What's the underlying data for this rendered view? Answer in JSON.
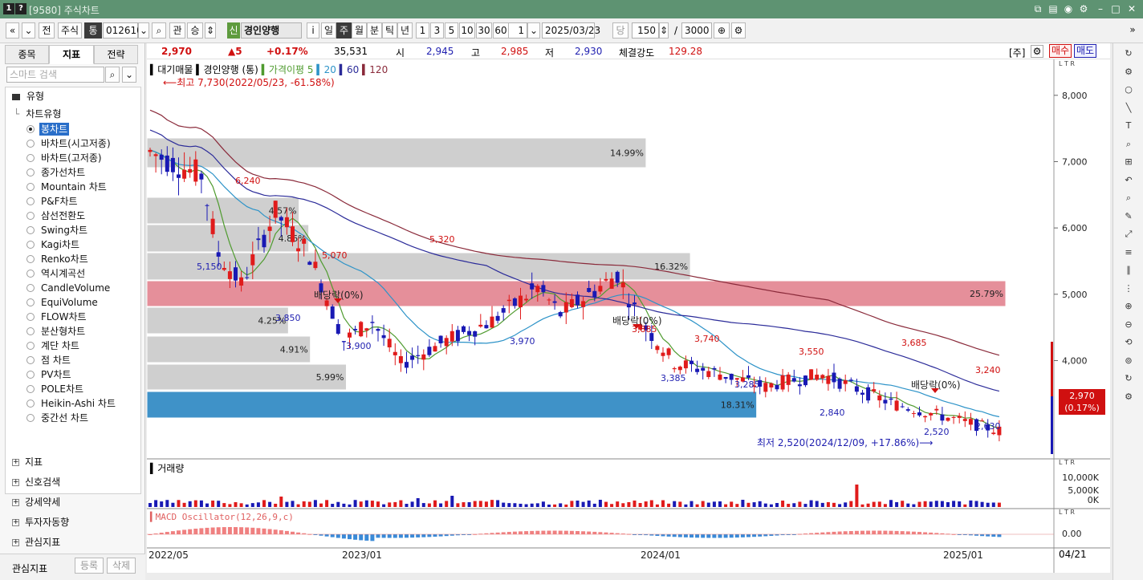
{
  "titlebar": {
    "num1": "1",
    "num2": "?",
    "title": "[9580] 주식차트"
  },
  "toolbar": {
    "nav_prev": "«",
    "nav_more": "»",
    "jeon": "전",
    "jusik": "주식",
    "tong": "통",
    "code": "012610",
    "gwan": "관",
    "seung": "승",
    "sin_badge": "신",
    "stock_name": "경인양행",
    "info": "i",
    "periods": [
      "일",
      "주",
      "월",
      "분",
      "틱",
      "년"
    ],
    "selected_period": "주",
    "minutes": [
      "1",
      "3",
      "5",
      "10",
      "30",
      "60"
    ],
    "unit_count": "1",
    "date": "2025/03/23",
    "dang": "당",
    "count": "150",
    "slash": "/",
    "max_count": "3000"
  },
  "left": {
    "tabs": [
      "종목",
      "지표",
      "전략"
    ],
    "active_tab": "지표",
    "search_placeholder": "스마트 검색",
    "type_header": "유형",
    "category": "차트유형",
    "chart_types": [
      "봉차트",
      "바차트(시고저종)",
      "바차트(고저종)",
      "종가선차트",
      "Mountain 차트",
      "P&F차트",
      "삼선전환도",
      "Swing차트",
      "Kagi차트",
      "Renko차트",
      "역시계곡선",
      "CandleVolume",
      "EquiVolume",
      "FLOW차트",
      "분산형차트",
      "계단 차트",
      "점 차트",
      "PV차트",
      "POLE차트",
      "Heikin-Ashi 차트",
      "중간선 차트"
    ],
    "selected_type": "봉차트",
    "sections": [
      "지표",
      "신호검색",
      "강세약세",
      "투자자동향",
      "관심지표"
    ],
    "bottom_label": "관심지표",
    "register": "등록",
    "delete": "삭제"
  },
  "quote": {
    "price": "2,970",
    "change": "▲5",
    "pct": "+0.17%",
    "volume": "35,531",
    "open_label": "시",
    "open": "2,945",
    "high_label": "고",
    "high": "2,985",
    "low_label": "저",
    "low": "2,930",
    "strength_label": "체결강도",
    "strength": "129.28",
    "unit": "[주]",
    "buy": "매수",
    "sell": "매도"
  },
  "chart": {
    "legend_vp": "대기매물",
    "legend_stock": "경인양행 (통)",
    "legend_ma": "가격이평 5",
    "legend_ma2": "20",
    "legend_ma3": "60",
    "legend_ma4": "120",
    "max_note": "⟵최고 7,730(2022/05/23, -61.58%)",
    "min_note": "최저 2,520(2024/12/09, +17.86%)⟶",
    "dividend_label": "배당락(0%)",
    "last_price": "2,970",
    "last_pct": "(0.17%)",
    "volume_title": "거래량",
    "macd_title": "MACD Oscillator(12,26,9,c)",
    "time_end": "04/21",
    "ltr": "L T R",
    "colors": {
      "up": "#e01b1b",
      "down": "#1919b4",
      "ma5": "#4f9b2f",
      "ma20": "#2d93c8",
      "ma60": "#2b2b99",
      "ma120": "#8a2a3a"
    }
  },
  "chart_data": {
    "type": "candlestick",
    "price_axis": {
      "ticks": [
        8000,
        7000,
        6000,
        5000,
        4000
      ],
      "range": [
        2300,
        8300
      ]
    },
    "volume_axis": {
      "ticks": [
        "10,000K",
        "5,000K",
        "0K"
      ]
    },
    "macd_axis": {
      "ticks": [
        "0.00"
      ]
    },
    "time_axis": {
      "labels": [
        "2022/05",
        "2023/01",
        "2024/01",
        "2025/01"
      ]
    },
    "price_labels": [
      "6,240",
      "5,150",
      "5,070",
      "3,850",
      "3,900",
      "5,320",
      "3,970",
      "3,885",
      "3,740",
      "3,385",
      "3,285",
      "3,550",
      "2,840",
      "3,685",
      "3,240",
      "2,520",
      "2,630"
    ],
    "volume_profile": [
      "14.99%",
      "4.57%",
      "4.86%",
      "16.32%",
      "25.79%",
      "4.25%",
      "4.91%",
      "5.99%",
      "18.31%"
    ],
    "dividend_events": 3
  },
  "rightbar": {
    "icons": [
      "refresh-icon",
      "settings-icon",
      "circle-icon",
      "line-icon",
      "text-icon",
      "zoom-icon",
      "ruler-icon",
      "undo-icon",
      "search-icon"
    ]
  }
}
